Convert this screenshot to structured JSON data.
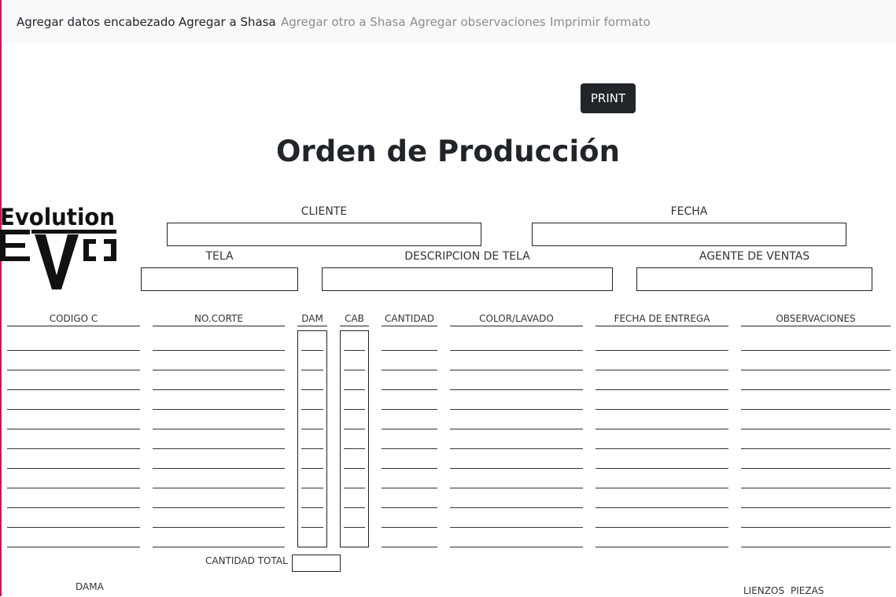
{
  "nav": {
    "items": [
      {
        "label": "Agregar datos encabezado",
        "state": "active"
      },
      {
        "label": "Agregar a Shasa",
        "state": "active"
      },
      {
        "label": "Agregar otro a Shasa",
        "state": "muted"
      },
      {
        "label": "Agregar observaciones",
        "state": "muted"
      },
      {
        "label": "Imprimir formato",
        "state": "muted"
      }
    ]
  },
  "print_button": "PRINT",
  "page_title": "Orden de Producción",
  "logo": {
    "text": "Evolution",
    "mark": "EVO"
  },
  "header_fields": {
    "cliente": {
      "label": "CLIENTE",
      "value": ""
    },
    "fecha": {
      "label": "FECHA",
      "value": ""
    },
    "tela": {
      "label": "TELA",
      "value": ""
    },
    "descripcion_tela": {
      "label": "DESCRIPCION DE TELA",
      "value": ""
    },
    "agente_ventas": {
      "label": "AGENTE DE VENTAS",
      "value": ""
    }
  },
  "table": {
    "columns": [
      "CODIGO C",
      "NO.CORTE",
      "DAM",
      "CAB",
      "CANTIDAD",
      "COLOR/LAVADO",
      "FECHA DE ENTREGA",
      "OBSERVACIONES"
    ],
    "row_count": 11
  },
  "totals": {
    "label": "CANTIDAD TOTAL",
    "value": ""
  },
  "footer": {
    "dama": "DAMA",
    "lienzos": "LIENZOS",
    "piezas": "PIEZAS"
  },
  "colors": {
    "accent_edge": "#c2185b",
    "dark_button": "#212529",
    "navbar_bg": "#f8f9fa"
  }
}
